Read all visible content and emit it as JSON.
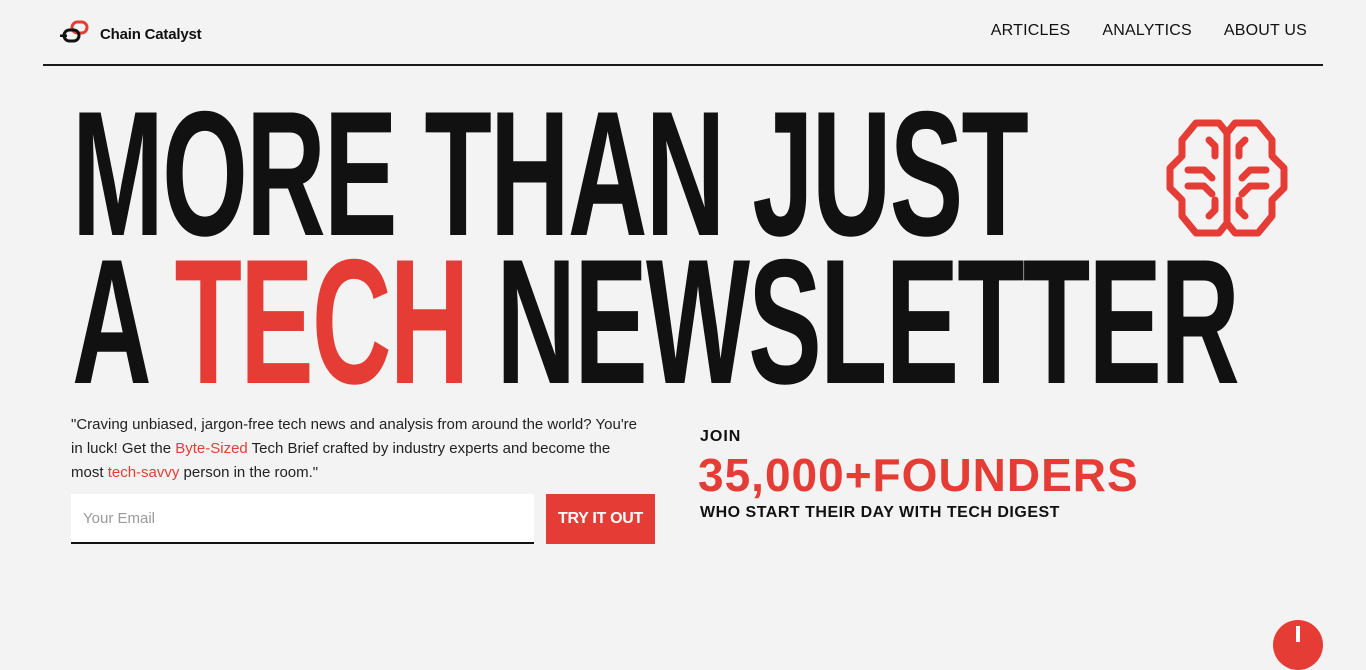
{
  "header": {
    "brand": "Chain Catalyst",
    "nav": [
      "ARTICLES",
      "ANALYTICS",
      "ABOUT US"
    ]
  },
  "hero": {
    "line1": "MORE THAN JUST",
    "line2_a": "A ",
    "line2_accent": "TECH",
    "line2_b": " NEWSLETTER"
  },
  "intro": {
    "part1": "\"Craving unbiased, jargon-free tech news and analysis from around the world? You're in luck! Get the ",
    "highlight1": "Byte-Sized",
    "part2": " Tech Brief crafted by industry experts and become the most ",
    "highlight2": "tech-savvy",
    "part3": " person in the room.\""
  },
  "form": {
    "placeholder": "Your Email",
    "button": "TRY IT OUT"
  },
  "stats": {
    "join": "JOIN",
    "count": "35,000+FOUNDERS",
    "tagline": "WHO START THEIR DAY WITH TECH DIGEST"
  },
  "icons": {
    "logo": "chain-link-icon",
    "hero": "brain-circuit-icon",
    "fab": "plus-icon"
  },
  "colors": {
    "accent": "#e53d35",
    "background": "#f3f3f3",
    "text": "#111111"
  }
}
